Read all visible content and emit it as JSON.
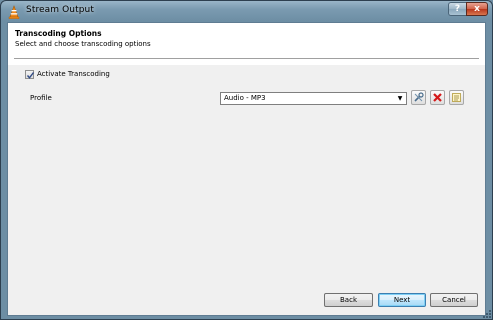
{
  "window": {
    "title": "Stream Output",
    "help_label": "?",
    "close_label": "x"
  },
  "header": {
    "title": "Transcoding Options",
    "subtitle": "Select and choose transcoding options"
  },
  "options": {
    "activate_label": "Activate Transcoding",
    "activate_checked": true,
    "profile_label": "Profile",
    "profile_value": "Audio - MP3",
    "profile_arrow": "▼"
  },
  "tools": {
    "edit_icon": "wrench-icon",
    "delete_icon": "red-x-icon",
    "new_icon": "new-profile-icon"
  },
  "buttons": {
    "back": "Back",
    "next": "Next",
    "cancel": "Cancel"
  },
  "colors": {
    "titlebar": "#7b9bb1",
    "close_button": "#c8472b",
    "default_button_border": "#3c7fb1",
    "background": "#f0f0f0"
  }
}
